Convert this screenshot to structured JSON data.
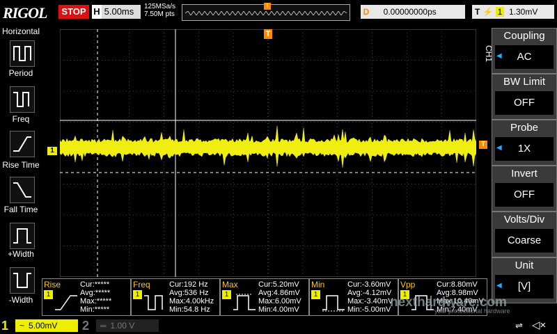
{
  "header": {
    "logo": "RIGOL",
    "run_state": "STOP",
    "h_label": "H",
    "timebase": "5.00ms",
    "sample_rate": "125MSa/s",
    "mem_depth": "7.50M pts",
    "delay_label": "D",
    "delay": "0.00000000ps",
    "trigger_label": "T",
    "trigger_source": "1",
    "trigger_level": "1.30mV"
  },
  "left_panel": {
    "title": "Horizontal",
    "items": [
      {
        "label": "Period",
        "icon": "period-icon"
      },
      {
        "label": "Freq",
        "icon": "freq-icon"
      },
      {
        "label": "Rise Time",
        "icon": "rise-time-icon"
      },
      {
        "label": "Fall Time",
        "icon": "fall-time-icon"
      },
      {
        "label": "+Width",
        "icon": "pos-width-icon"
      },
      {
        "label": "-Width",
        "icon": "neg-width-icon"
      }
    ]
  },
  "right_panel": {
    "channel_tag": "CH1",
    "items": [
      {
        "title": "Coupling",
        "value": "AC"
      },
      {
        "title": "BW Limit",
        "value": "OFF"
      },
      {
        "title": "Probe",
        "value": "1X"
      },
      {
        "title": "Invert",
        "value": "OFF"
      },
      {
        "title": "Volts/Div",
        "value": "Coarse"
      },
      {
        "title": "Unit",
        "value": "[V]"
      }
    ]
  },
  "markers": {
    "trigger_top": "T",
    "ch1_marker": "1",
    "trigger_right": "T"
  },
  "measurements": [
    {
      "name": "Rise",
      "num": "1",
      "lines": [
        "Cur:*****",
        "Avg:*****",
        "Max:*****",
        "Min:*****"
      ]
    },
    {
      "name": "Freq",
      "num": "1",
      "lines": [
        "Cur:192 Hz",
        "Avg:536 Hz",
        "Max:4.00kHz",
        "Min:54.8 Hz"
      ]
    },
    {
      "name": "Max",
      "num": "1",
      "lines": [
        "Cur:5.20mV",
        "Avg:4.86mV",
        "Max:6.00mV",
        "Min:4.00mV"
      ]
    },
    {
      "name": "Min",
      "num": "1",
      "lines": [
        "Cur:-3.60mV",
        "Avg:-4.12mV",
        "Max:-3.40mV",
        "Min:-5.00mV"
      ]
    },
    {
      "name": "Vpp",
      "num": "1",
      "lines": [
        "Cur:8.80mV",
        "Avg:8.98mV",
        "Max:10.40mV",
        "Min:7.40mV"
      ]
    }
  ],
  "bottom": {
    "ch1_num": "1",
    "ch1_coupling": "~",
    "ch1_scale": "5.00mV",
    "ch2_num": "2",
    "ch2_scale": "1.00 V"
  },
  "watermark": {
    "text": "nexthardware.com",
    "sub": "your professional hardware"
  },
  "colors": {
    "trace": "#f0ee10",
    "trigger": "#ff8a00",
    "stop": "#dd1111"
  }
}
